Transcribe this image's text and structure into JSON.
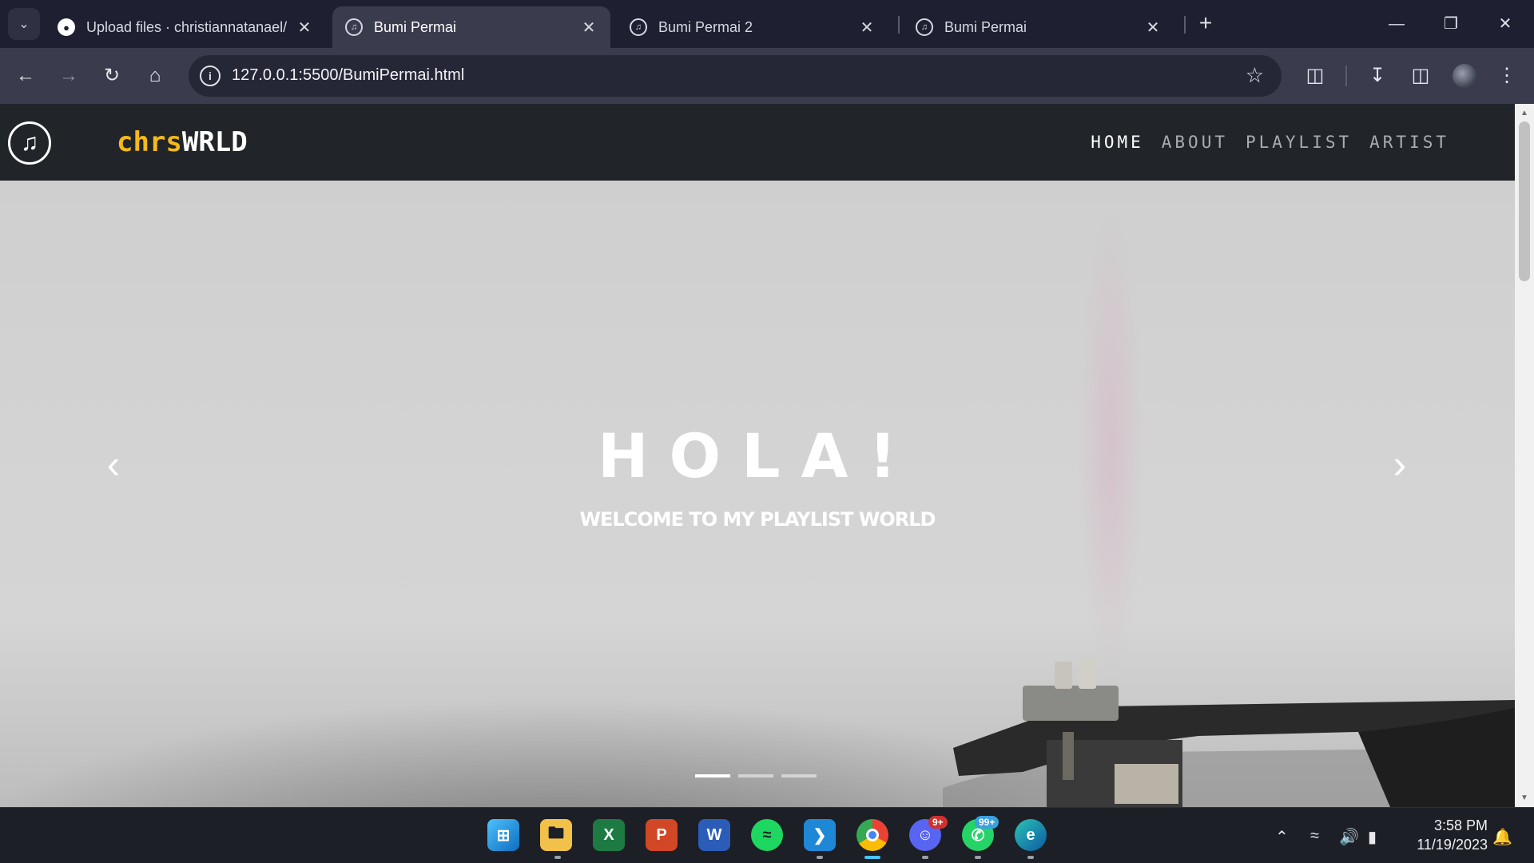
{
  "browser": {
    "tabs": [
      {
        "label": "Upload files · christiannatanael/",
        "icon": "github-icon"
      },
      {
        "label": "Bumi Permai",
        "icon": "music-note-icon",
        "active": true
      },
      {
        "label": "Bumi Permai 2",
        "icon": "music-note-icon"
      },
      {
        "label": "Bumi Permai",
        "icon": "music-note-icon"
      }
    ],
    "new_tab": "+",
    "url": "127.0.0.1:5500/BumiPermai.html"
  },
  "site": {
    "brand_part1": "chrs",
    "brand_part2": "WRLD",
    "nav": [
      "HOME",
      "ABOUT",
      "PLAYLIST",
      "ARTIST"
    ],
    "active_nav": "HOME",
    "hero_title": "HOLA!",
    "hero_subtitle": "WELCOME TO MY PLAYLIST WORLD",
    "carousel_slide_count": 3,
    "carousel_active_index": 0
  },
  "taskbar": {
    "apps": [
      "windows-start",
      "file-explorer",
      "excel",
      "powerpoint",
      "word",
      "spotify",
      "vscode",
      "chrome",
      "discord",
      "whatsapp",
      "edge"
    ],
    "discord_badge": "9+",
    "whatsapp_badge": "99+",
    "time": "3:58 PM",
    "date": "11/19/2023"
  }
}
